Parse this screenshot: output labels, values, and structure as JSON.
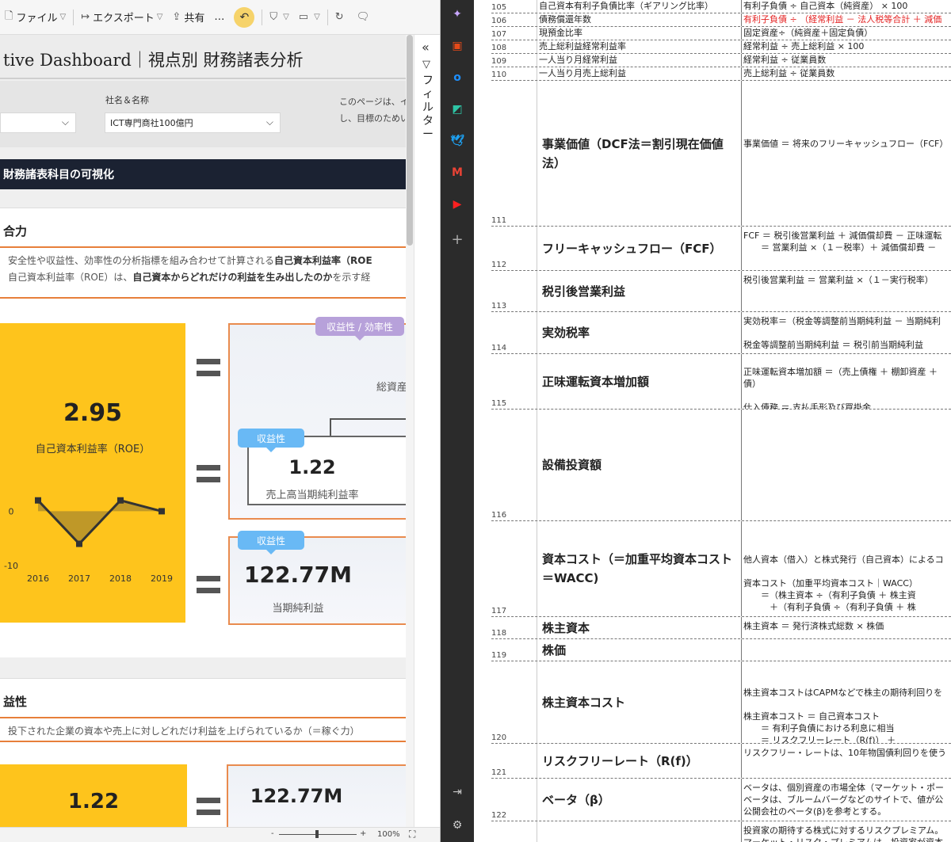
{
  "toolbar": {
    "file": "ファイル",
    "export": "エクスポート",
    "share": "共有",
    "more": "…"
  },
  "report": {
    "title": "tive Dashboard｜視点別 財務諸表分析",
    "slicer_left_value": "",
    "company_label": "社名＆名称",
    "company_value": "ICT専門商社100億円",
    "note_line1": "このページは、イ",
    "note_line2": "し、目標のためい",
    "banner": "財務諸表科目の可視化",
    "section1": {
      "title": "合力",
      "desc_line1_pre": "安全性や収益性、効率性の分析指標を組み合わせて計算される",
      "desc_line1_bold": "自己資本利益率（ROE",
      "desc_line2_pre": "自己資本利益率（ROE）は、",
      "desc_line2_bold": "自己資本からどれだけの利益を生み出したのか",
      "desc_line2_post": "を示す経",
      "roe_value": "2.95",
      "roe_label": "自己資本利益率（ROE）",
      "tag_profit_eff": "収益性 / 効率性",
      "total_assets_label": "総資産",
      "tag_profit": "収益性",
      "net_margin_value": "1.22",
      "net_margin_label": "売上高当期純利益率",
      "tag_profit2": "収益性",
      "net_income_value": "122.77M",
      "net_income_label": "当期純利益"
    },
    "section2": {
      "title": "益性",
      "desc": "投下された企業の資本や売上に対しどれだけ利益を上げられているか（＝稼ぐ力）",
      "val1": "1.22",
      "val2": "122.77M"
    }
  },
  "chart_data": {
    "type": "line",
    "categories": [
      "2016",
      "2017",
      "2018",
      "2019"
    ],
    "values": [
      2,
      -6,
      2,
      0
    ],
    "ylim": [
      -10,
      4
    ],
    "ytick_labels": [
      "0",
      "-10"
    ],
    "area_fill": true
  },
  "filter_pane": {
    "collapse": "«",
    "label": "フィルター"
  },
  "status": {
    "zoom": "100%"
  },
  "sheet": {
    "rows": [
      {
        "num": "105",
        "a": "自己資本有利子負債比率（ギアリング比率）",
        "b": "有利子負債 ÷ 自己資本（純資産） × 100"
      },
      {
        "num": "106",
        "a": "債務償還年数",
        "b": "有利子負債 ÷ （経常利益 － 法人税等合計 ＋ 減価"
      },
      {
        "num": "107",
        "a": "現預金比率",
        "b": "固定資産÷（純資産＋固定負債）"
      },
      {
        "num": "108",
        "a": "売上総利益経常利益率",
        "b": "経常利益 ÷ 売上総利益 × 100"
      },
      {
        "num": "109",
        "a": "一人当り月経常利益",
        "b": "経常利益 ÷ 従業員数"
      },
      {
        "num": "110",
        "a": "一人当り月売上総利益",
        "b": "売上総利益 ÷ 従業員数"
      },
      {
        "num": "111",
        "a": "事業価値（DCF法＝割引現在価値法）",
        "b": "事業価値 ＝ 将来のフリーキャッシュフロー（FCF）"
      },
      {
        "num": "112",
        "a": "フリーキャッシュフロー（FCF）",
        "b": "FCF ＝ 税引後営業利益 ＋ 減価償却費 － 正味運転\n　　＝ 営業利益 ×（１－税率）＋ 減価償却費 －"
      },
      {
        "num": "113",
        "a": "税引後営業利益",
        "b": "税引後営業利益 ＝ 営業利益 ×（１－実行税率）"
      },
      {
        "num": "114",
        "a": "実効税率",
        "b": "実効税率＝（税金等調整前当期純利益 － 当期純利\n\n税金等調整前当期純利益 ＝ 税引前当期純利益"
      },
      {
        "num": "115",
        "a": "正味運転資本増加額",
        "b": "正味運転資本増加額 ＝（売上債権 ＋ 棚卸資産 ＋\n債）\n\n仕入債務 ＝ 支払手形及び買掛金"
      },
      {
        "num": "116",
        "a": "設備投資額",
        "b": ""
      },
      {
        "num": "117",
        "a": "資本コスト（＝加重平均資本コスト＝WACC)",
        "b": "他人資本（借入）と株式発行（自己資本）によるコ\n\n資本コスト（加重平均資本コスト｜WACC）\n　　＝（株主資本 ÷（有利子負債 ＋ 株主資\n　　　＋（有利子負債 ÷（有利子負債 ＋ 株"
      },
      {
        "num": "118",
        "a": "株主資本",
        "b": "株主資本 ＝ 発行済株式総数 × 株価"
      },
      {
        "num": "119",
        "a": "株価",
        "b": ""
      },
      {
        "num": "120",
        "a": "株主資本コスト",
        "b": "株主資本コストはCAPMなどで株主の期待利回りを\n\n株主資本コスト ＝ 自己資本コスト\n　　＝ 有利子負債における利息に相当\n　　＝ リスクフリーレート（R(f)） ＋\n（R(q))"
      },
      {
        "num": "121",
        "a": "リスクフリーレート（R(f)）",
        "b": "リスクフリー・レートは、10年物国債利回りを使う"
      },
      {
        "num": "122",
        "a": "ベータ（β）",
        "b": "ベータは、個別資産の市場全体（マーケット・ポー\nベータは、ブルームバーグなどのサイトで、値が公\n公開会社のベータ(β)を参考とする。"
      },
      {
        "num": "",
        "a": "",
        "b": "投資家の期待する株式に対するリスクプレミアム。\nマーケット・リスク・プレミアムは、投資家が資本"
      }
    ]
  },
  "colors": {
    "accent_yellow": "#fec41c",
    "accent_orange": "#e98b4e",
    "banner_navy": "#1b2232",
    "tag_blue": "#69b9f5",
    "tag_purple": "#b7a1da",
    "formula_red": "#e42323"
  }
}
